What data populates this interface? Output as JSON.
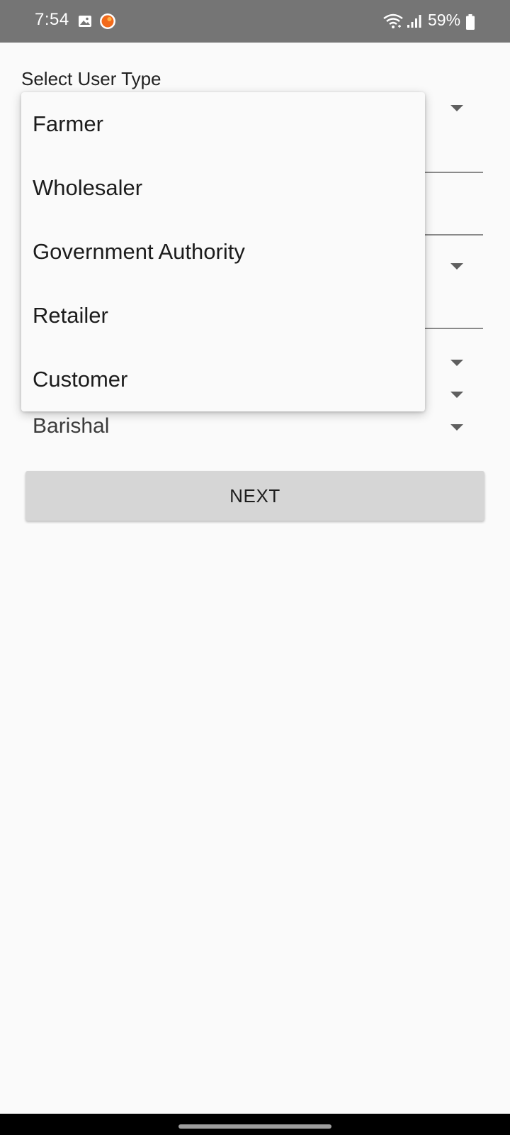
{
  "status_bar": {
    "time": "7:54",
    "battery": "59%",
    "icons": [
      "gallery-icon",
      "app-notification-icon",
      "wifi-icon",
      "signal-icon",
      "battery-icon"
    ]
  },
  "form": {
    "user_type_label": "Select User Type",
    "district_value": "Barishal",
    "next_label": "NEXT"
  },
  "dropdown": {
    "options": [
      "Farmer",
      "Wholesaler",
      "Government Authority",
      "Retailer",
      "Customer"
    ]
  },
  "colors": {
    "status_bar": "#757575",
    "background": "#fafafa",
    "button": "#d6d6d6",
    "app_icon": "#f26a1b"
  }
}
